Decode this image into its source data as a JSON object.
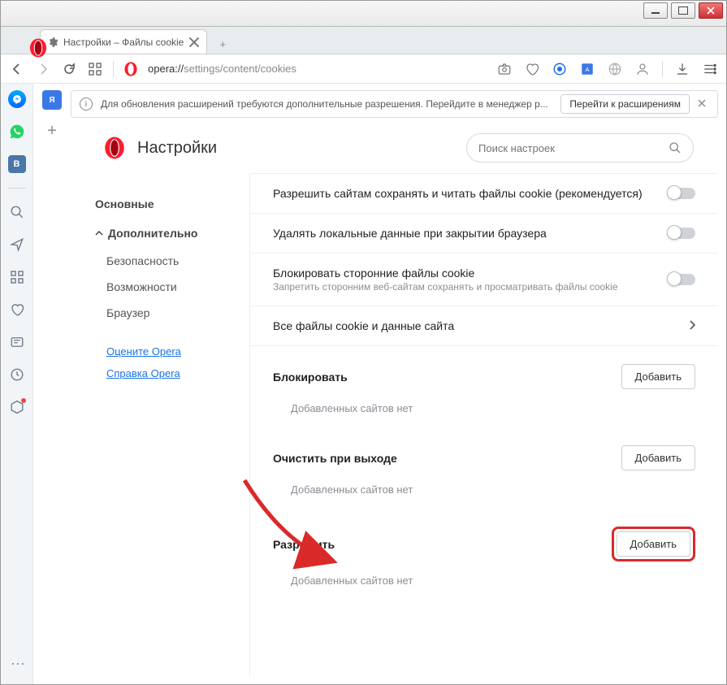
{
  "tab": {
    "title": "Настройки – Файлы cookie"
  },
  "address": {
    "scheme": "opera://",
    "path": "settings/content/cookies"
  },
  "infobar": {
    "text": "Для обновления расширений требуются дополнительные разрешения. Перейдите в менеджер р...",
    "button": "Перейти к расширениям"
  },
  "header": {
    "title": "Настройки"
  },
  "search": {
    "placeholder": "Поиск настроек"
  },
  "nav": {
    "basic": "Основные",
    "advanced": "Дополнительно",
    "security": "Безопасность",
    "features": "Возможности",
    "browser": "Браузер",
    "rate": "Оцените Opera",
    "help": "Справка Opera"
  },
  "options": {
    "allow_cookies": "Разрешить сайтам сохранять и читать файлы cookie (рекомендуется)",
    "clear_on_exit": "Удалять локальные данные при закрытии браузера",
    "block_third_title": "Блокировать сторонние файлы cookie",
    "block_third_desc": "Запретить сторонним веб-сайтам сохранять и просматривать файлы cookie",
    "all_cookies": "Все файлы cookie и данные сайта"
  },
  "sections": {
    "block": {
      "title": "Блокировать",
      "add": "Добавить",
      "empty": "Добавленных сайтов нет"
    },
    "clear": {
      "title": "Очистить при выходе",
      "add": "Добавить",
      "empty": "Добавленных сайтов нет"
    },
    "allow": {
      "title": "Разрешить",
      "add": "Добавить",
      "empty": "Добавленных сайтов нет"
    }
  }
}
